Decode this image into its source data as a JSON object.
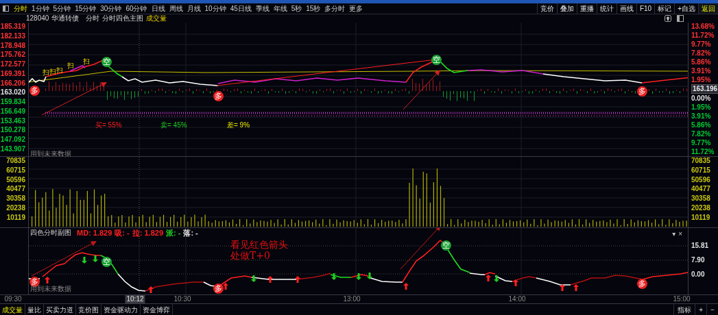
{
  "toolbar": {
    "periods": [
      {
        "label": "分时",
        "selected": true
      },
      {
        "label": "1分钟",
        "selected": false
      },
      {
        "label": "5分钟",
        "selected": false
      },
      {
        "label": "15分钟",
        "selected": false
      },
      {
        "label": "30分钟",
        "selected": false
      },
      {
        "label": "60分钟",
        "selected": false
      },
      {
        "label": "日线",
        "selected": false
      },
      {
        "label": "周线",
        "selected": false
      },
      {
        "label": "月线",
        "selected": false
      },
      {
        "label": "10分钟",
        "selected": false
      },
      {
        "label": "45日线",
        "selected": false
      },
      {
        "label": "季线",
        "selected": false
      },
      {
        "label": "年线",
        "selected": false
      },
      {
        "label": "5秒",
        "selected": false
      },
      {
        "label": "15秒",
        "selected": false
      },
      {
        "label": "多分时",
        "selected": false
      },
      {
        "label": "更多",
        "selected": false
      }
    ],
    "actions": [
      {
        "label": "竞价",
        "kind": "plain"
      },
      {
        "label": "叠加",
        "kind": "plain"
      },
      {
        "label": "重播",
        "kind": "plain"
      },
      {
        "label": "统计",
        "kind": "plain"
      },
      {
        "label": "画线",
        "kind": "plain"
      },
      {
        "label": "F10",
        "kind": "plain"
      },
      {
        "label": "标记",
        "kind": "plain"
      },
      {
        "label": "+自选",
        "kind": "plain"
      },
      {
        "label": "返回",
        "kind": "accent"
      }
    ]
  },
  "header": {
    "code": "128040",
    "name": "华通转债",
    "mode": "分时",
    "main_chart": "分时四色主图",
    "indicator": "成交量"
  },
  "price_pane": {
    "left_labels": [
      {
        "text": "185.319",
        "color": "#ff3434"
      },
      {
        "text": "182.133",
        "color": "#ff3434"
      },
      {
        "text": "178.948",
        "color": "#ff3434"
      },
      {
        "text": "175.762",
        "color": "#ff3434"
      },
      {
        "text": "172.577",
        "color": "#ff3434"
      },
      {
        "text": "169.391",
        "color": "#ff3434"
      },
      {
        "text": "166.206",
        "color": "#ff3434"
      },
      {
        "text": "163.020",
        "color": "#e0e0e0"
      },
      {
        "text": "159.834",
        "color": "#00cc33"
      },
      {
        "text": "156.649",
        "color": "#00cc33"
      },
      {
        "text": "153.463",
        "color": "#00cc33"
      },
      {
        "text": "150.278",
        "color": "#00cc33"
      },
      {
        "text": "147.092",
        "color": "#00cc33"
      },
      {
        "text": "143.907",
        "color": "#00cc33"
      }
    ],
    "right_labels": [
      {
        "text": "13.68%",
        "color": "#ff3434"
      },
      {
        "text": "11.72%",
        "color": "#ff3434"
      },
      {
        "text": "9.77%",
        "color": "#ff3434"
      },
      {
        "text": "7.82%",
        "color": "#ff3434"
      },
      {
        "text": "5.86%",
        "color": "#ff3434"
      },
      {
        "text": "3.91%",
        "color": "#ff3434"
      },
      {
        "text": "1.95%",
        "color": "#ff3434"
      },
      {
        "text": "0.00%",
        "color": "#e0e0e0"
      },
      {
        "text": "1.95%",
        "color": "#00cc33"
      },
      {
        "text": "3.91%",
        "color": "#00cc33"
      },
      {
        "text": "5.86%",
        "color": "#00cc33"
      },
      {
        "text": "7.82%",
        "color": "#00cc33"
      },
      {
        "text": "9.77%",
        "color": "#00cc33"
      },
      {
        "text": "11.72%",
        "color": "#00cc33"
      }
    ],
    "price_tag": "163.196",
    "markers": [
      {
        "label": "多",
        "kind": "buy"
      },
      {
        "label": "扫",
        "kind": "scan"
      },
      {
        "label": "扫",
        "kind": "scan"
      },
      {
        "label": "扫",
        "kind": "scan"
      },
      {
        "label": "扫",
        "kind": "scan"
      },
      {
        "label": "扫",
        "kind": "scan"
      },
      {
        "label": "空",
        "kind": "sell"
      },
      {
        "label": "多",
        "kind": "buy"
      },
      {
        "label": "空",
        "kind": "sell"
      },
      {
        "label": "多",
        "kind": "buy"
      }
    ],
    "stats": [
      {
        "text": "买= 55%",
        "color": "#ff2020"
      },
      {
        "text": "卖= 45%",
        "color": "#20d020"
      },
      {
        "text": "差= 9%",
        "color": "#e8e800"
      }
    ],
    "note": "用到未来数据"
  },
  "volume_pane": {
    "left_labels": [
      "70835",
      "60715",
      "50596",
      "40477",
      "30358",
      "20238",
      "10119"
    ],
    "right_labels": [
      "70835",
      "60715",
      "50596",
      "40477",
      "30358",
      "20238",
      "10119"
    ]
  },
  "sub_pane": {
    "title": "四色分时副图",
    "readings": [
      {
        "text": "MD: 1.829",
        "color": "#ff2020"
      },
      {
        "text": "吸: -",
        "color": "#ff2020"
      },
      {
        "text": "拉: 1.829",
        "color": "#ff2020"
      },
      {
        "text": "派: -",
        "color": "#20d020"
      },
      {
        "text": "落: -",
        "color": "#e0e0e0"
      }
    ],
    "controls": [
      "▾",
      "×"
    ],
    "right_labels": [
      "15.81",
      "7.90",
      "0.00"
    ],
    "tip": "看见红色箭头处做T+0",
    "note": "用到未来数据",
    "markers": [
      {
        "label": "多",
        "kind": "buy"
      },
      {
        "label": "空",
        "kind": "sell"
      },
      {
        "label": "多",
        "kind": "buy"
      },
      {
        "label": "空",
        "kind": "sell"
      },
      {
        "label": "多",
        "kind": "buy"
      }
    ]
  },
  "time_axis": [
    {
      "label": "09:30",
      "selected": false
    },
    {
      "label": "10:12",
      "selected": true
    },
    {
      "label": "10:30",
      "selected": false
    },
    {
      "label": "13:00",
      "selected": false
    },
    {
      "label": "14:00",
      "selected": false
    },
    {
      "label": "15:00",
      "selected": false
    }
  ],
  "bottom_tabs": [
    {
      "label": "成交量",
      "selected": true
    },
    {
      "label": "量比",
      "selected": false
    },
    {
      "label": "买卖力道",
      "selected": false
    },
    {
      "label": "竞价图",
      "selected": false
    },
    {
      "label": "资金驱动力",
      "selected": false
    },
    {
      "label": "资金博弈",
      "selected": false
    }
  ],
  "bottom_tools": [
    "指标",
    "+",
    "−"
  ]
}
